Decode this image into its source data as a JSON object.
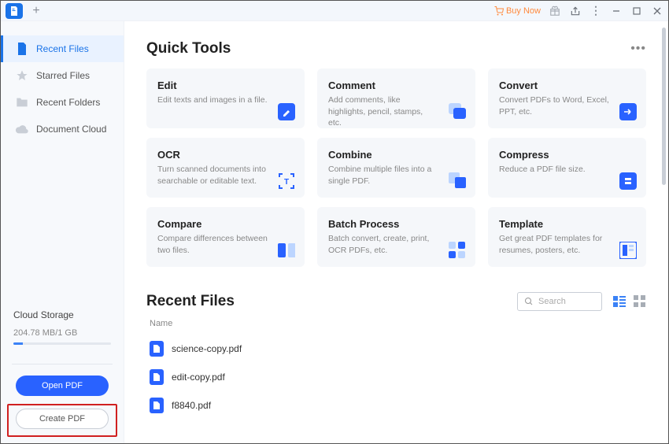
{
  "titlebar": {
    "buy_now": "Buy Now"
  },
  "sidebar": {
    "items": [
      {
        "label": "Recent Files"
      },
      {
        "label": "Starred Files"
      },
      {
        "label": "Recent Folders"
      },
      {
        "label": "Document Cloud"
      }
    ]
  },
  "cloud": {
    "title": "Cloud Storage",
    "usage": "204.78 MB/1 GB"
  },
  "buttons": {
    "open_pdf": "Open PDF",
    "create_pdf": "Create PDF"
  },
  "quick_tools": {
    "title": "Quick Tools",
    "cards": [
      {
        "title": "Edit",
        "desc": "Edit texts and images in a file."
      },
      {
        "title": "Comment",
        "desc": "Add comments, like highlights, pencil, stamps, etc."
      },
      {
        "title": "Convert",
        "desc": "Convert PDFs to Word, Excel, PPT, etc."
      },
      {
        "title": "OCR",
        "desc": "Turn scanned documents into searchable or editable text."
      },
      {
        "title": "Combine",
        "desc": "Combine multiple files into a single PDF."
      },
      {
        "title": "Compress",
        "desc": "Reduce a PDF file size."
      },
      {
        "title": "Compare",
        "desc": "Compare differences between two files."
      },
      {
        "title": "Batch Process",
        "desc": "Batch convert, create, print, OCR PDFs, etc."
      },
      {
        "title": "Template",
        "desc": "Get great PDF templates for resumes, posters, etc."
      }
    ]
  },
  "recent": {
    "title": "Recent Files",
    "search_placeholder": "Search",
    "name_col": "Name",
    "files": [
      {
        "name": "science-copy.pdf"
      },
      {
        "name": "edit-copy.pdf"
      },
      {
        "name": "f8840.pdf"
      }
    ]
  }
}
